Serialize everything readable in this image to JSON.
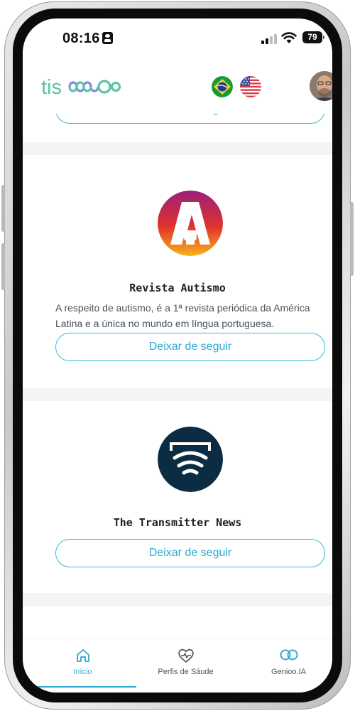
{
  "status_bar": {
    "time": "08:16",
    "battery": "79"
  },
  "header": {
    "logo_text": "tismoo",
    "flags": [
      "brazil-flag",
      "usa-flag"
    ]
  },
  "feed": {
    "previous_card": {
      "follow_label": "Deixar de seguir"
    },
    "cards": [
      {
        "title": "Revista Autismo",
        "description": "A respeito de autismo, é a 1ª revista periódica da América Latina e a única no mundo em língua portuguesa.",
        "follow_label": "Deixar de seguir",
        "logo_letter": "A"
      },
      {
        "title": "The Transmitter News",
        "follow_label": "Deixar de seguir"
      }
    ]
  },
  "bottom_nav": {
    "items": [
      {
        "label": "Início",
        "icon": "home-icon",
        "active": true
      },
      {
        "label": "Perfis de Sáude",
        "icon": "heart-pulse-icon",
        "active": false
      },
      {
        "label": "Genioo.IA",
        "icon": "infinity-icon",
        "active": false
      }
    ]
  },
  "colors": {
    "accent": "#2fa9d1",
    "logo": "#5cc3a6",
    "separator": "#f3f4f5",
    "transmitter_bg": "#0c2c44"
  }
}
